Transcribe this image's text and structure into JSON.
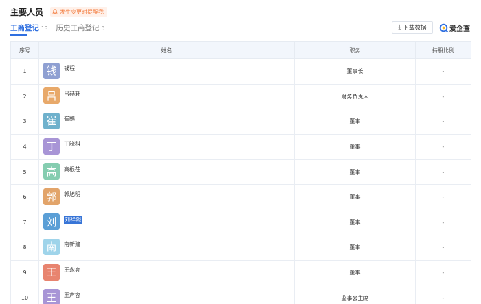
{
  "header": {
    "title": "主要人员",
    "alert": "发生变更时提醒我"
  },
  "tabs": [
    {
      "label": "工商登记",
      "count": "13"
    },
    {
      "label": "历史工商登记",
      "count": "0"
    }
  ],
  "toolbar": {
    "download_label": "下载数据",
    "brand_name": "爱企查"
  },
  "table": {
    "columns": [
      "序号",
      "姓名",
      "职务",
      "持股比例"
    ],
    "rows": [
      {
        "index": "1",
        "avatar_char": "钱",
        "avatar_color": "#8fa0d2",
        "name": "钱程",
        "role": "董事长",
        "share": "-"
      },
      {
        "index": "2",
        "avatar_char": "吕",
        "avatar_color": "#e8a96a",
        "name": "吕赫轩",
        "role": "财务负责人",
        "share": "-"
      },
      {
        "index": "3",
        "avatar_char": "崔",
        "avatar_color": "#6fb1cc",
        "name": "崔鹏",
        "role": "董事",
        "share": "-"
      },
      {
        "index": "4",
        "avatar_char": "丁",
        "avatar_color": "#a895d6",
        "name": "丁晓科",
        "role": "董事",
        "share": "-"
      },
      {
        "index": "5",
        "avatar_char": "高",
        "avatar_color": "#85cdb0",
        "name": "高根茌",
        "role": "董事",
        "share": "-"
      },
      {
        "index": "6",
        "avatar_char": "郭",
        "avatar_color": "#e2a46a",
        "name": "郭旭明",
        "role": "董事",
        "share": "-"
      },
      {
        "index": "7",
        "avatar_char": "刘",
        "avatar_color": "#5b9fd6",
        "name": "刘祥熙",
        "role": "董事",
        "share": "-"
      },
      {
        "index": "8",
        "avatar_char": "南",
        "avatar_color": "#9fd4ea",
        "name": "南新建",
        "role": "董事",
        "share": "-"
      },
      {
        "index": "9",
        "avatar_char": "王",
        "avatar_color": "#e8846f",
        "name": "王永亮",
        "role": "董事",
        "share": "-"
      },
      {
        "index": "10",
        "avatar_char": "王",
        "avatar_color": "#a895d6",
        "name": "王声容",
        "role": "监事会主席",
        "share": "-"
      }
    ]
  },
  "colors": {
    "accent": "#2f6fe0",
    "alert_text": "#f37b3d",
    "selection": "#3875d7"
  },
  "icons": [
    "bell-icon",
    "download-icon",
    "brand-logo-icon"
  ]
}
